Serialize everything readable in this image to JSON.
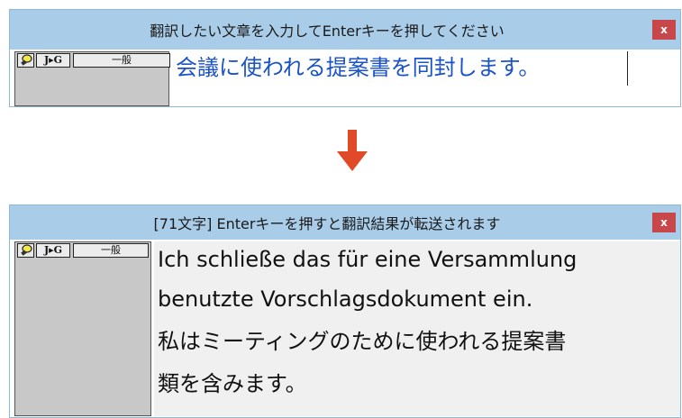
{
  "top_window": {
    "title": "翻訳したい文章を入力してEnterキーを押してください",
    "close_label": "x",
    "tools": {
      "direction_label": "J▸G",
      "dictionary_label": "一般"
    },
    "input_value": "会議に使われる提案書を同封します。"
  },
  "bottom_window": {
    "title": "[71文字] Enterキーを押すと翻訳結果が転送されます",
    "close_label": "x",
    "tools": {
      "direction_label": "J▸G",
      "dictionary_label": "一般"
    },
    "result_lines": [
      "Ich schließe das für eine Versammlung",
      "benutzte Vorschlagsdokument ein.",
      "私はミーティングのために使われる提案書",
      "類を含みます。"
    ]
  },
  "colors": {
    "titlebar": "#a9cde8",
    "close": "#c8474a",
    "input_text": "#1a52c8",
    "arrow": "#e04a28"
  },
  "icons": [
    "lightbulb-icon",
    "down-arrow-icon",
    "close-icon"
  ]
}
